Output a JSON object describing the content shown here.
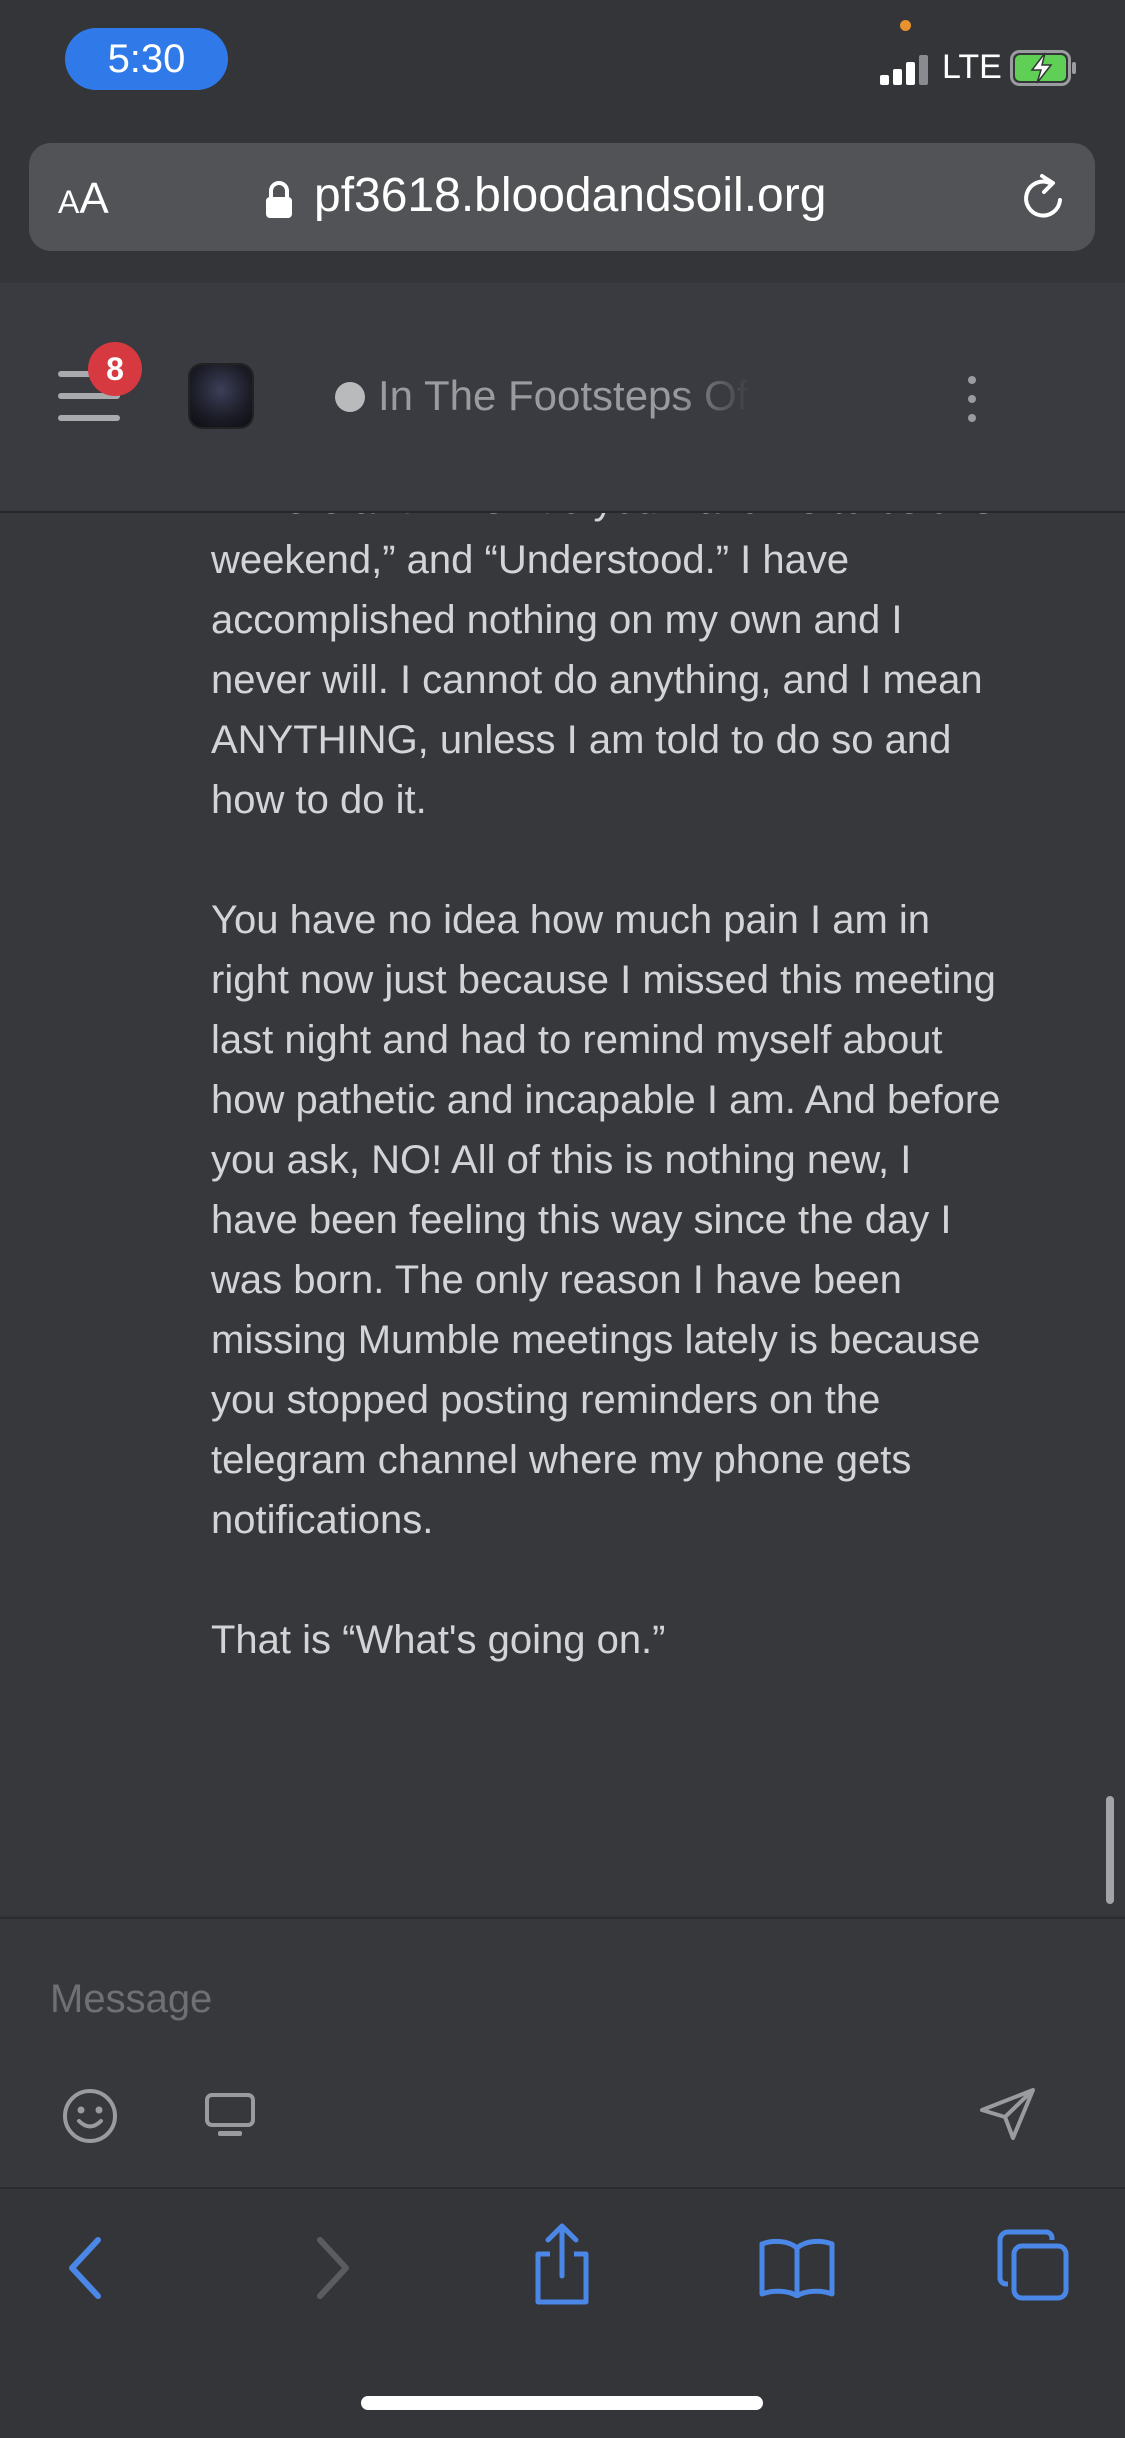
{
  "status_bar": {
    "time": "5:30",
    "network": "LTE"
  },
  "browser": {
    "text_size_button": {
      "small": "A",
      "large": "A"
    },
    "url": "pf3618.bloodandsoil.org"
  },
  "chat_header": {
    "notification_count": "8",
    "channel_name": "In The Footsteps Of"
  },
  "message": {
    "paragraphs": [
      "“Where and when do you want me to be this weekend,” and “Understood.” I have accomplished nothing on my own and I never will. I cannot do anything, and I mean ANYTHING, unless I am told to do so and how to do it.",
      "You have no idea how much pain I am in right now just because I missed this meeting last night and had to remind myself about how pathetic and incapable I am. And before you ask, NO! All of this is nothing new, I have been feeling this way since the day I was born. The only reason I have been missing Mumble meetings lately is because you stopped posting reminders on the telegram channel where my phone gets notifications.",
      "That is “What's going on.”"
    ]
  },
  "composer": {
    "placeholder": "Message"
  },
  "icons": {
    "signal": "signal-icon",
    "battery": "battery-charging-icon",
    "lock": "lock-icon",
    "reload": "reload-icon",
    "menu": "hamburger-menu-icon",
    "more": "more-vertical-icon",
    "emoji": "emoji-icon",
    "screen": "screen-share-icon",
    "send": "send-icon",
    "back": "chevron-left-icon",
    "forward": "chevron-right-icon",
    "share": "share-icon",
    "bookmarks": "book-icon",
    "tabs": "tabs-icon"
  },
  "colors": {
    "accent_blue": "#2f7ae8",
    "badge_red": "#d6393f",
    "background": "#333539",
    "text": "#d3d4d6",
    "muted": "#9a9b9e",
    "nav_blue": "#4b87e6"
  }
}
